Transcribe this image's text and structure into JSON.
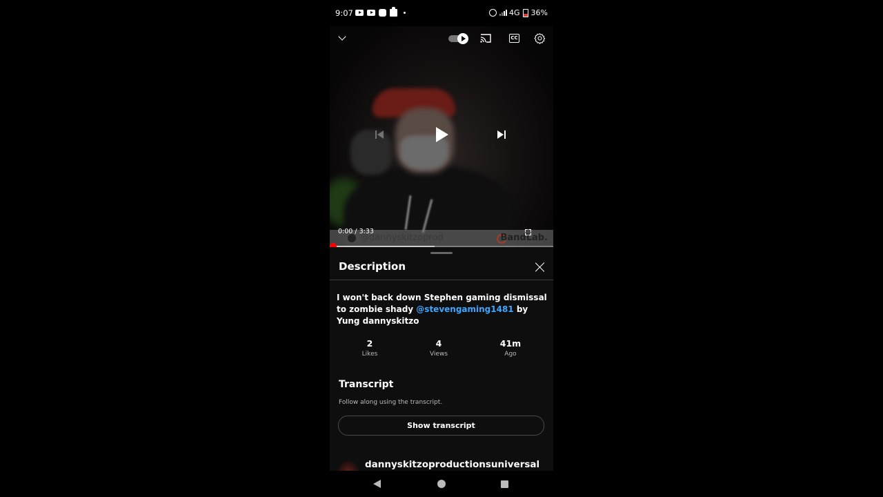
{
  "status_bar": {
    "time": "9:07",
    "notification_icons": [
      "youtube-icon",
      "youtube-icon",
      "app-icon",
      "puzzle-icon",
      "dot-icon"
    ],
    "network": "4G",
    "battery": "36%"
  },
  "player": {
    "top_controls": [
      "minimize-chevron-icon",
      "autoplay-toggle",
      "cast-icon",
      "captions-icon",
      "settings-gear-icon"
    ],
    "captions_label": "CC",
    "current_time": "0:00",
    "duration": "3:33",
    "timecode": "0:00 / 3:33",
    "progress_fraction": 0.0,
    "buffered_fraction": 0.47,
    "watermark_handle": "@dannyskitzoprod",
    "watermark_brand": "BandLab.",
    "accent_color": "#ff0000"
  },
  "description_panel": {
    "title": "Description",
    "video_title_parts": {
      "before": "I won't back down Stephen gaming dismissal to zombie shady ",
      "mention": "@stevengaming1481",
      "after": " by Yung dannyskitzo"
    },
    "mention_color": "#3ea6ff",
    "stats": [
      {
        "value": "2",
        "label": "Likes"
      },
      {
        "value": "4",
        "label": "Views"
      },
      {
        "value": "41m",
        "label": "Ago"
      }
    ],
    "transcript": {
      "heading": "Transcript",
      "subtitle": "Follow along using the transcript.",
      "button_label": "Show transcript"
    },
    "channel_name": "dannyskitzoproductionsuniversal"
  },
  "nav_bar": [
    "back",
    "home",
    "recents"
  ]
}
